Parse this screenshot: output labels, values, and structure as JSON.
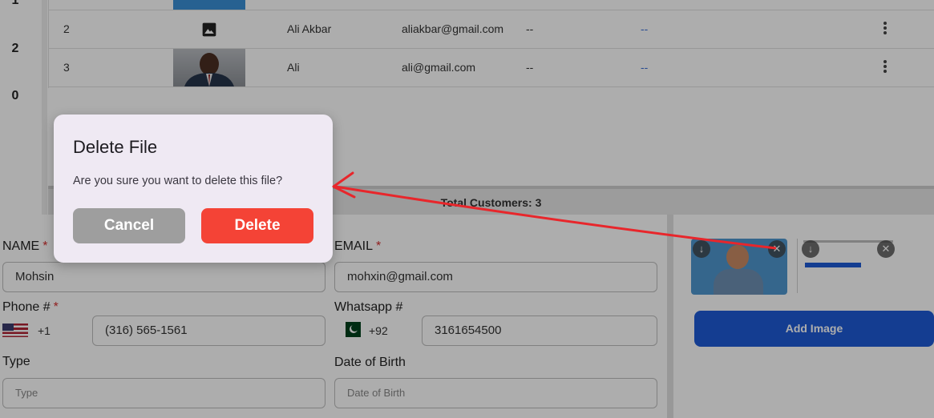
{
  "table": {
    "left_numbers": [
      "1",
      "2",
      "0"
    ],
    "rows": [
      {
        "index": "2",
        "name": "Ali Akbar",
        "email": "aliakbar@gmail.com",
        "col5": "--",
        "col6": "--"
      },
      {
        "index": "3",
        "name": "Ali",
        "email": "ali@gmail.com",
        "col5": "--",
        "col6": "--"
      }
    ],
    "footer": "Total Customers: 3"
  },
  "form": {
    "name_label": "NAME",
    "name_value": "Mohsin",
    "email_label": "EMAIL",
    "email_value": "mohxin@gmail.com",
    "phone_label": "Phone #",
    "phone_code": "+1",
    "phone_value": "(316) 565-1561",
    "whatsapp_label": "Whatsapp #",
    "whatsapp_code": "+92",
    "whatsapp_value": "3161654500",
    "type_label": "Type",
    "type_placeholder": "Type",
    "dob_label": "Date of Birth",
    "dob_placeholder": "Date of Birth",
    "required_mark": "*"
  },
  "images": {
    "add_button": "Add Image"
  },
  "dialog": {
    "title": "Delete File",
    "message": "Are you sure you want to delete this file?",
    "cancel": "Cancel",
    "delete": "Delete"
  },
  "icons": {
    "row_image_placeholder": "image-icon",
    "row_menu": "more-vertical-icon",
    "download": "download-icon",
    "remove": "close-icon",
    "arrow": "annotation-arrow"
  },
  "colors": {
    "delete": "#f44336",
    "cancel": "#9e9e9e",
    "add_image": "#1e5bd6",
    "annotation": "#e8262b"
  }
}
